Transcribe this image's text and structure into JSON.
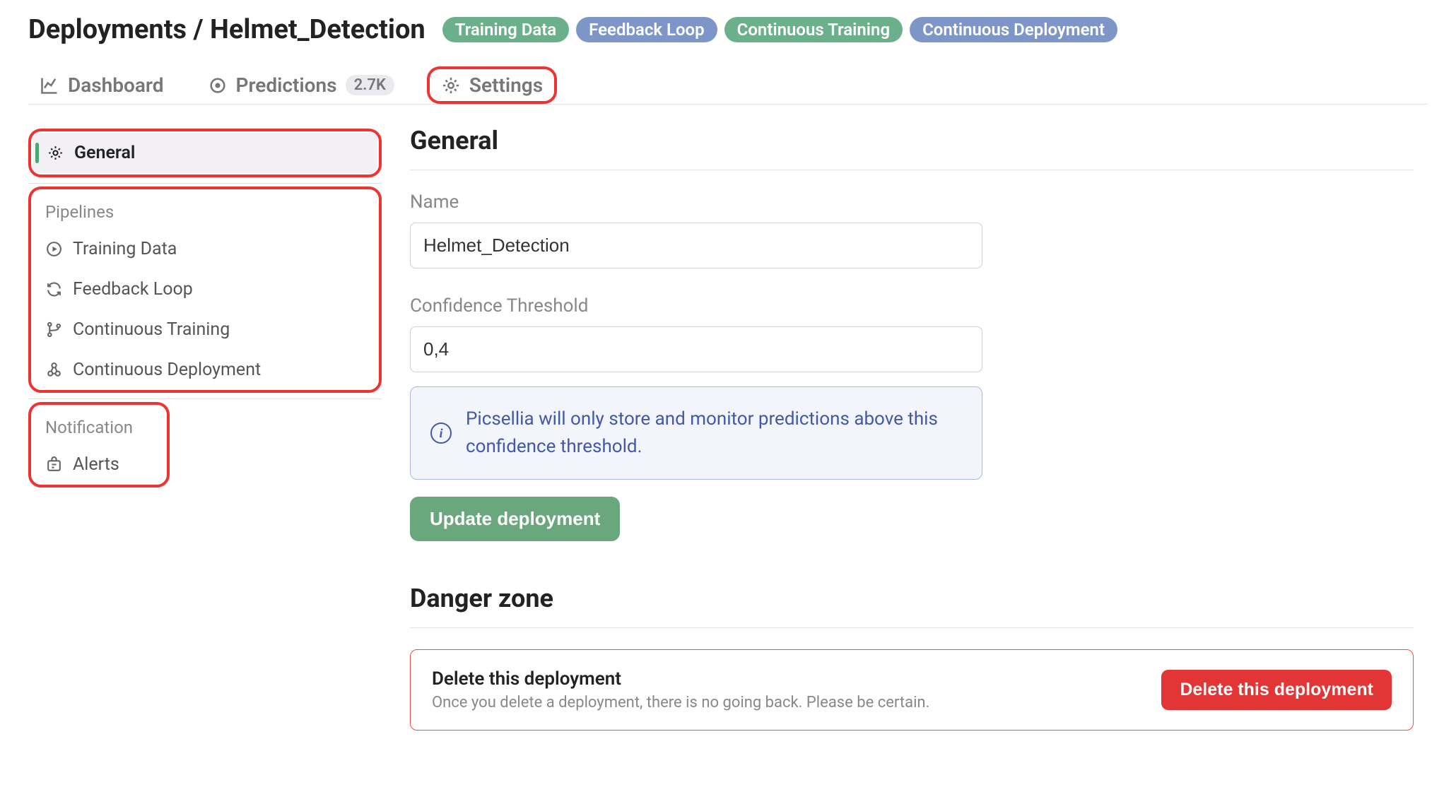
{
  "header": {
    "breadcrumb": "Deployments / Helmet_Detection",
    "badges": [
      "Training Data",
      "Feedback Loop",
      "Continuous Training",
      "Continuous Deployment"
    ]
  },
  "tabs": {
    "dashboard": "Dashboard",
    "predictions": "Predictions",
    "predictions_count": "2.7K",
    "settings": "Settings"
  },
  "sidebar": {
    "general": "General",
    "pipelines_label": "Pipelines",
    "pipelines": {
      "training_data": "Training Data",
      "feedback_loop": "Feedback Loop",
      "continuous_training": "Continuous Training",
      "continuous_deployment": "Continuous Deployment"
    },
    "notification_label": "Notification",
    "alerts": "Alerts"
  },
  "main": {
    "general_title": "General",
    "name_label": "Name",
    "name_value": "Helmet_Detection",
    "threshold_label": "Confidence Threshold",
    "threshold_value": "0,4",
    "info_text": "Picsellia will only store and monitor predictions above this confidence threshold.",
    "update_button": "Update deployment",
    "danger_title": "Danger zone",
    "delete_title": "Delete this deployment",
    "delete_sub": "Once you delete a deployment, there is no going back. Please be certain.",
    "delete_button": "Delete this deployment"
  }
}
